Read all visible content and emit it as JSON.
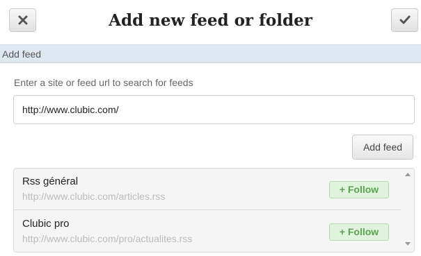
{
  "header": {
    "title": "Add new feed or folder",
    "close_icon": "close-x-icon",
    "save_icon": "checkmark-icon"
  },
  "section": {
    "label": "Add feed"
  },
  "form": {
    "hint": "Enter a site or feed url to search for feeds",
    "url_value": "http://www.clubic.com/",
    "add_button_label": "Add feed"
  },
  "results": [
    {
      "name": "Rss général",
      "url": "http://www.clubic.com/articles.rss",
      "follow_label": "+ Follow"
    },
    {
      "name": "Clubic pro",
      "url": "http://www.clubic.com/pro/actualites.rss",
      "follow_label": "+ Follow"
    }
  ],
  "colors": {
    "section_bar": "#dfe8f1",
    "follow_bg": "#e0f3dc",
    "follow_text": "#59a44f"
  }
}
